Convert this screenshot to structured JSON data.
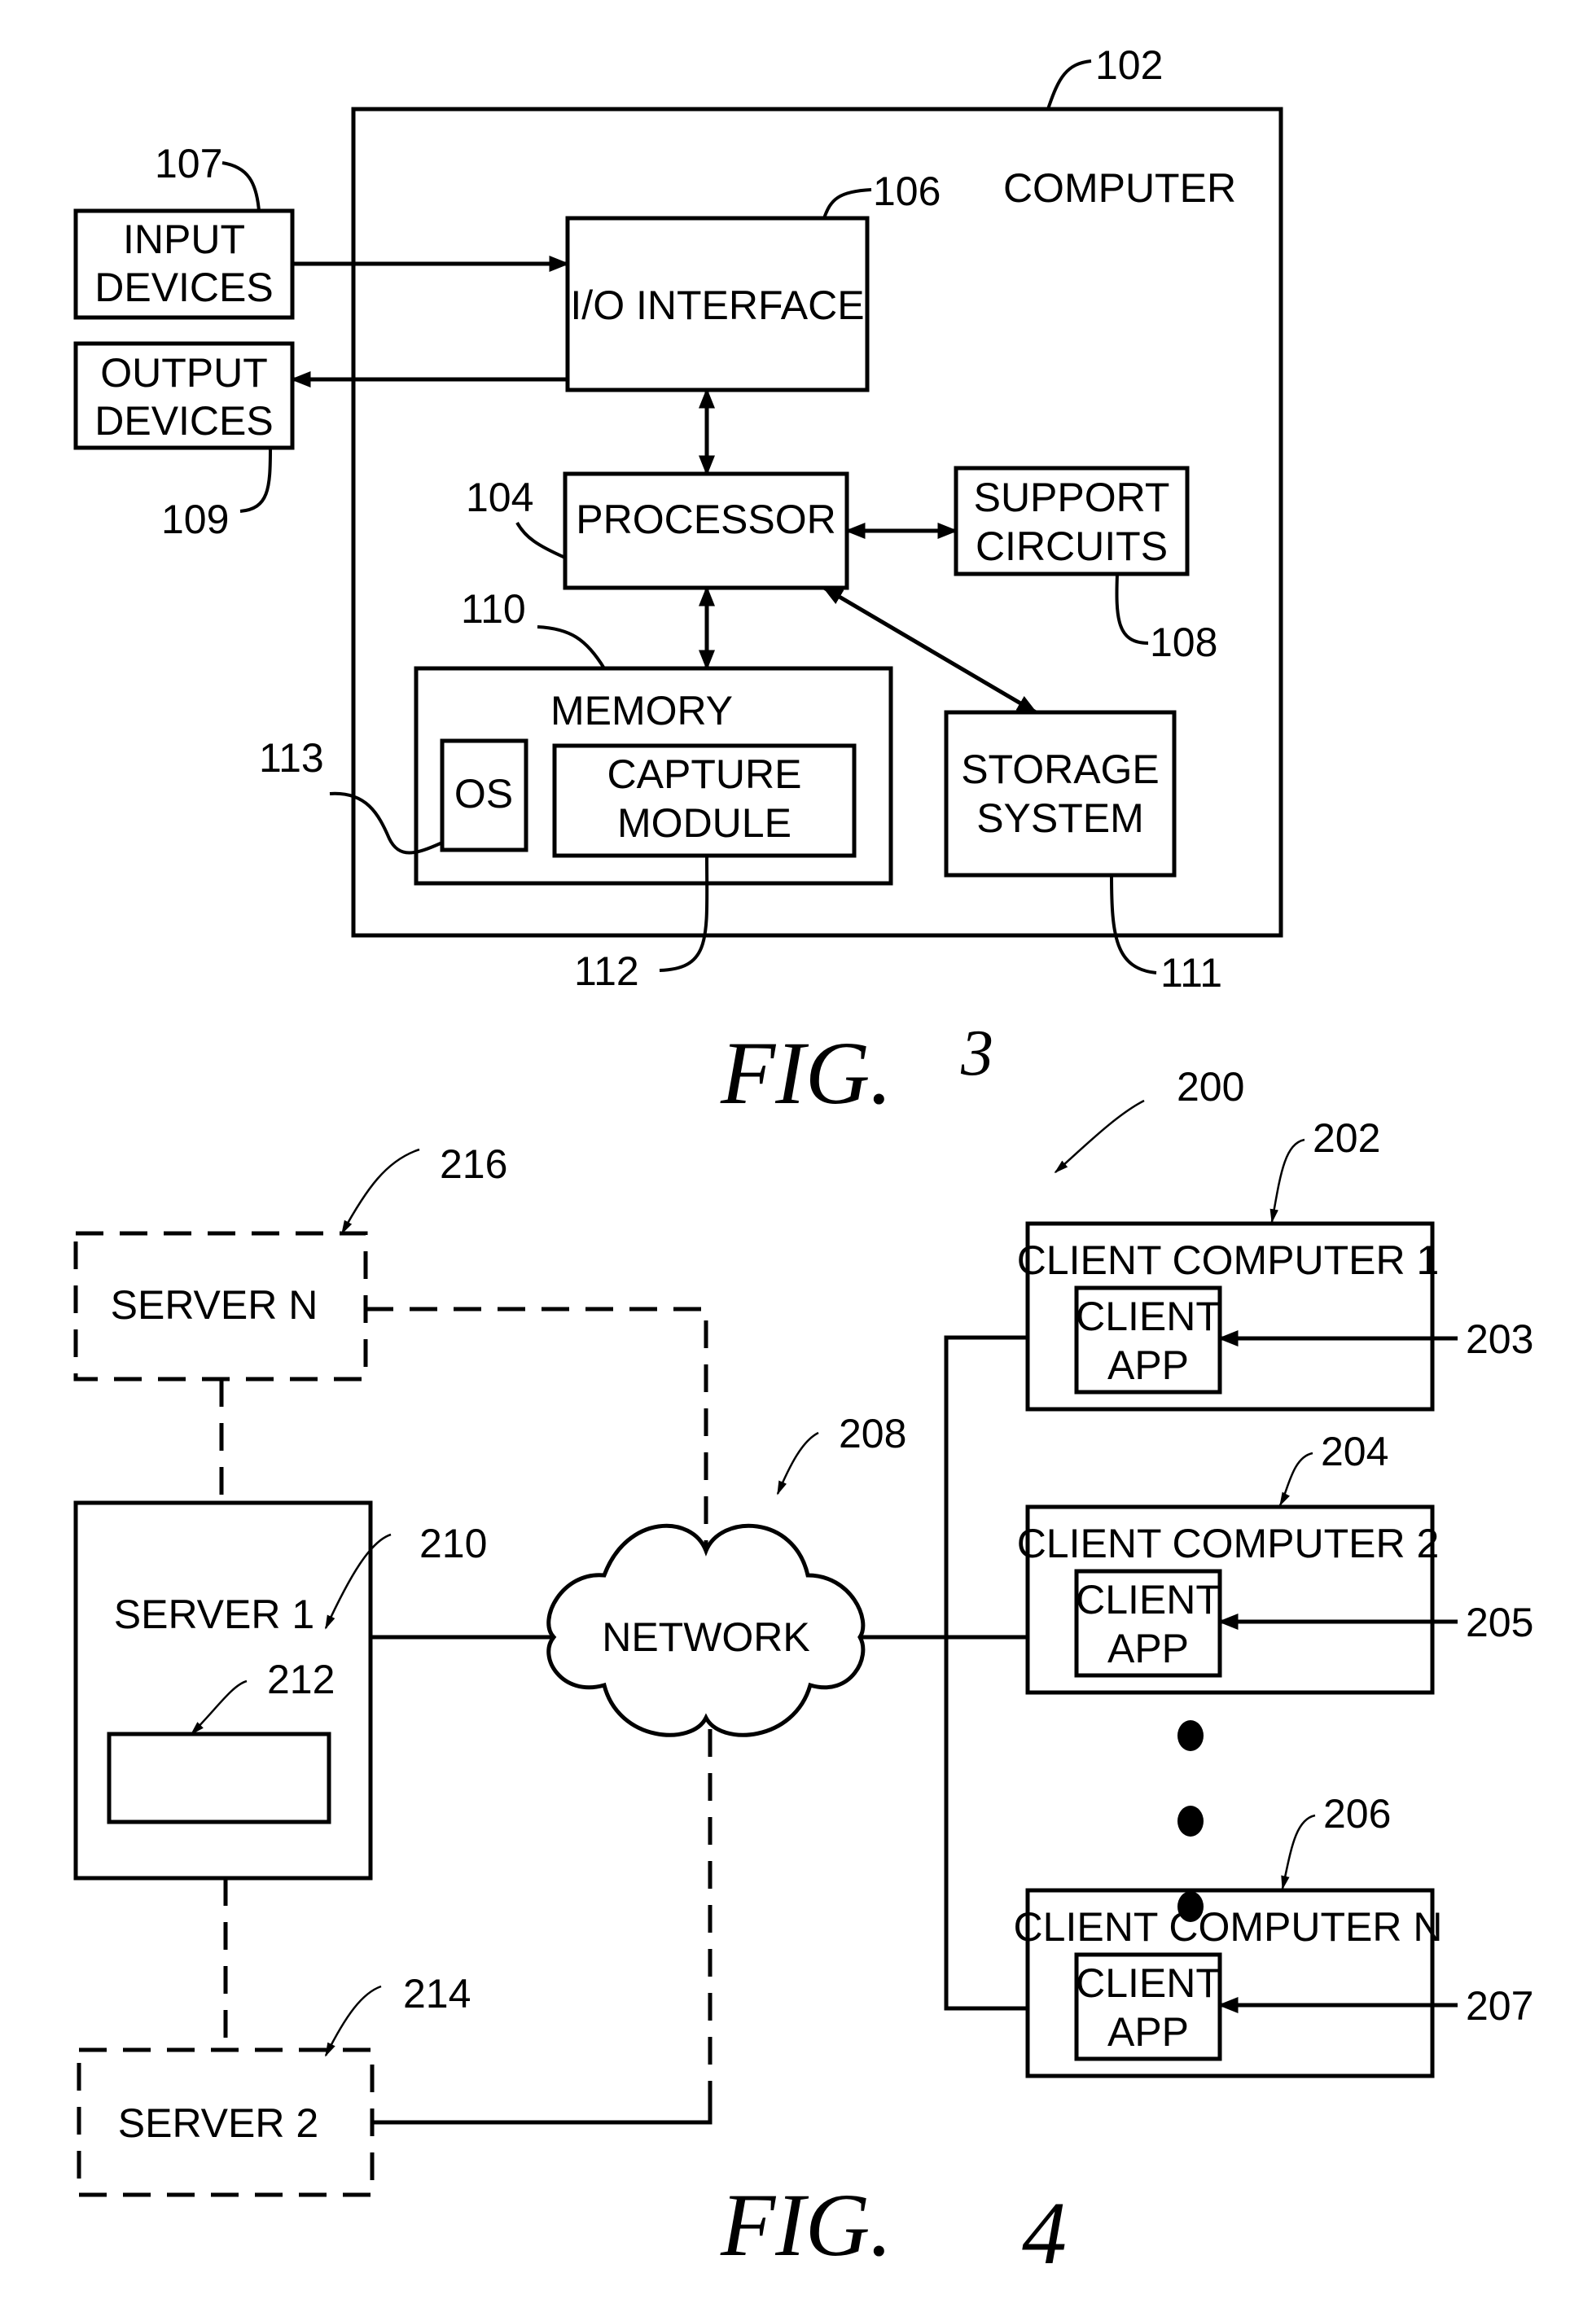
{
  "fig3": {
    "caption": "FIG.",
    "number": "3",
    "computer": {
      "ref": "102",
      "label": "COMPUTER"
    },
    "io_interface": {
      "ref": "106",
      "label": "I/O INTERFACE"
    },
    "processor": {
      "ref": "104",
      "label": "PROCESSOR"
    },
    "support_circuits": {
      "ref": "108",
      "lines": [
        "SUPPORT",
        "CIRCUITS"
      ]
    },
    "memory": {
      "ref": "110",
      "label": "MEMORY"
    },
    "os": {
      "ref": "113",
      "label": "OS"
    },
    "capture_module": {
      "ref": "112",
      "lines": [
        "CAPTURE",
        "MODULE"
      ]
    },
    "storage_system": {
      "ref": "111",
      "lines": [
        "STORAGE",
        "SYSTEM"
      ]
    },
    "input_devices": {
      "ref": "107",
      "lines": [
        "INPUT",
        "DEVICES"
      ]
    },
    "output_devices": {
      "ref": "109",
      "lines": [
        "OUTPUT",
        "DEVICES"
      ]
    }
  },
  "fig4": {
    "caption": "FIG.",
    "number": "4",
    "system_ref": "200",
    "server_n": {
      "ref": "216",
      "label": "SERVER N"
    },
    "server_1": {
      "ref": "210",
      "label": "SERVER 1",
      "component_ref": "212"
    },
    "server_2": {
      "ref": "214",
      "label": "SERVER 2"
    },
    "network": {
      "ref": "208",
      "label": "NETWORK"
    },
    "clients": [
      {
        "ref": "202",
        "label": "CLIENT COMPUTER 1",
        "app_ref": "203",
        "app_lines": [
          "CLIENT",
          "APP"
        ]
      },
      {
        "ref": "204",
        "label": "CLIENT COMPUTER 2",
        "app_ref": "205",
        "app_lines": [
          "CLIENT",
          "APP"
        ]
      },
      {
        "ref": "206",
        "label": "CLIENT COMPUTER N",
        "app_ref": "207",
        "app_lines": [
          "CLIENT",
          "APP"
        ]
      }
    ],
    "ellipsis_dots": 3
  }
}
